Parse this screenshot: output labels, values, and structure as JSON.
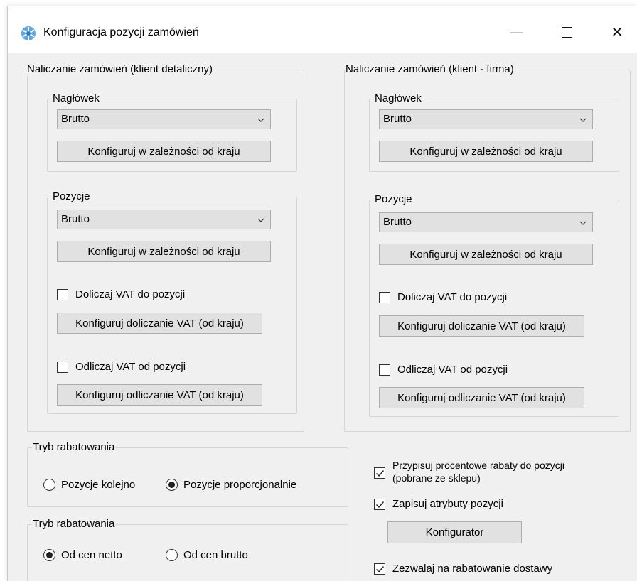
{
  "window": {
    "title": "Konfiguracja pozycji zamówień",
    "minimize_glyph": "—",
    "maximize_glyph": "☐",
    "close_glyph": "✕"
  },
  "left_group": {
    "legend": "Naliczanie zamówień (klient detaliczny)",
    "header_group": {
      "legend": "Nagłówek",
      "combo_value": "Brutto",
      "config_button": "Konfiguruj w zależności od kraju"
    },
    "positions_group": {
      "legend": "Pozycje",
      "combo_value": "Brutto",
      "config_button": "Konfiguruj w zależności od kraju",
      "add_vat_label": "Doliczaj VAT do pozycji",
      "add_vat_checked": false,
      "add_vat_button": "Konfiguruj doliczanie VAT (od kraju)",
      "sub_vat_label": "Odliczaj VAT od pozycji",
      "sub_vat_checked": false,
      "sub_vat_button": "Konfiguruj odliczanie VAT (od kraju)"
    }
  },
  "right_group": {
    "legend": "Naliczanie zamówień (klient - firma)",
    "header_group": {
      "legend": "Nagłówek",
      "combo_value": "Brutto",
      "config_button": "Konfiguruj w zależności od kraju"
    },
    "positions_group": {
      "legend": "Pozycje",
      "combo_value": "Brutto",
      "config_button": "Konfiguruj w zależności od kraju",
      "add_vat_label": "Doliczaj VAT do pozycji",
      "add_vat_checked": false,
      "add_vat_button": "Konfiguruj doliczanie VAT (od kraju)",
      "sub_vat_label": "Odliczaj VAT od pozycji",
      "sub_vat_checked": false,
      "sub_vat_button": "Konfiguruj odliczanie VAT (od kraju)"
    }
  },
  "discount_mode_1": {
    "legend": "Tryb rabatowania",
    "option_1": "Pozycje kolejno",
    "option_2": "Pozycje proporcjonalnie",
    "selected": "Pozycje proporcjonalnie"
  },
  "discount_mode_2": {
    "legend": "Tryb rabatowania",
    "option_1": "Od cen netto",
    "option_2": "Od cen brutto",
    "selected": "Od cen netto"
  },
  "options": {
    "assign_discounts_line1": "Przypisuj procentowe rabaty do pozycji",
    "assign_discounts_line2": "(pobrane ze sklepu)",
    "assign_discounts_checked": true,
    "save_attributes": "Zapisuj atrybuty pozycji",
    "save_attributes_checked": true,
    "configurator_button": "Konfigurator",
    "allow_shipping_discount": "Zezwalaj na rabatowanie dostawy",
    "allow_shipping_discount_checked": true
  },
  "colors": {
    "window_bg": "#f0f0f0",
    "button_bg": "#e1e1e1",
    "border": "#adadad",
    "group_border": "#d5d5d5"
  }
}
